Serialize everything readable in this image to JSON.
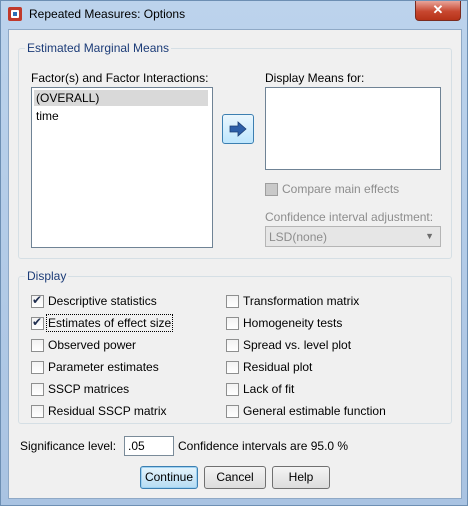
{
  "window": {
    "title": "Repeated Measures: Options",
    "close_label": "✕"
  },
  "emm": {
    "legend": "Estimated Marginal Means",
    "factors_label": "Factor(s) and Factor Interactions:",
    "factors": [
      "(OVERALL)",
      "time"
    ],
    "selected_factor": "(OVERALL)",
    "display_means_label": "Display Means for:",
    "display_means_items": [],
    "compare_main_effects": {
      "label": "Compare main effects",
      "checked": false,
      "enabled": false
    },
    "ci_adjustment_label": "Confidence interval adjustment:",
    "ci_adjustment_value": "LSD(none)",
    "move_button_icon": "right-arrow-icon"
  },
  "display": {
    "legend": "Display",
    "left": [
      {
        "label": "Descriptive statistics",
        "checked": true
      },
      {
        "label": "Estimates of effect size",
        "checked": true
      },
      {
        "label": "Observed power",
        "checked": false
      },
      {
        "label": "Parameter estimates",
        "checked": false
      },
      {
        "label": "SSCP matrices",
        "checked": false
      },
      {
        "label": "Residual SSCP matrix",
        "checked": false
      }
    ],
    "right": [
      {
        "label": "Transformation matrix",
        "checked": false
      },
      {
        "label": "Homogeneity tests",
        "checked": false
      },
      {
        "label": "Spread vs. level plot",
        "checked": false
      },
      {
        "label": "Residual plot",
        "checked": false
      },
      {
        "label": "Lack of fit",
        "checked": false
      },
      {
        "label": "General estimable function",
        "checked": false
      }
    ]
  },
  "significance": {
    "label": "Significance level:",
    "value": ".05",
    "ci_text": "Confidence intervals are 95.0 %"
  },
  "buttons": {
    "continue": "Continue",
    "cancel": "Cancel",
    "help": "Help"
  },
  "colors": {
    "legend_text": "#1c3c78",
    "default_button_border": "#3c7fb1"
  }
}
